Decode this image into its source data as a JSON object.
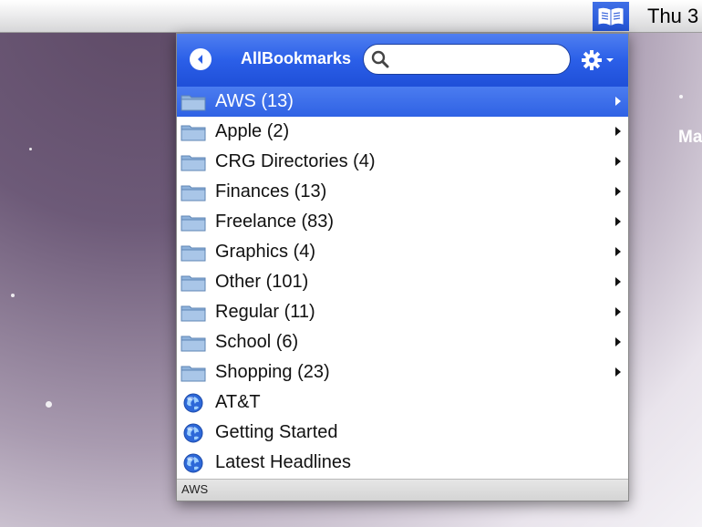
{
  "menubar": {
    "clock": "Thu 3",
    "app_icon": "open-book-icon"
  },
  "desktop": {
    "side_text": "Ma"
  },
  "popover": {
    "title": "AllBookmarks",
    "search_placeholder": "",
    "back_icon": "back-arrow-icon",
    "gear_icon": "gear-icon",
    "items": [
      {
        "label": "AWS (13)",
        "type": "folder",
        "selected": true
      },
      {
        "label": "Apple (2)",
        "type": "folder"
      },
      {
        "label": "CRG Directories (4)",
        "type": "folder"
      },
      {
        "label": "Finances (13)",
        "type": "folder"
      },
      {
        "label": "Freelance (83)",
        "type": "folder"
      },
      {
        "label": "Graphics (4)",
        "type": "folder"
      },
      {
        "label": "Other (101)",
        "type": "folder"
      },
      {
        "label": "Regular (11)",
        "type": "folder"
      },
      {
        "label": "School (6)",
        "type": "folder"
      },
      {
        "label": "Shopping (23)",
        "type": "folder"
      },
      {
        "label": "AT&T",
        "type": "link"
      },
      {
        "label": "Getting Started",
        "type": "link"
      },
      {
        "label": "Latest Headlines",
        "type": "link"
      }
    ],
    "status": "AWS"
  },
  "colors": {
    "header_blue": "#2b5fe8",
    "selection_blue": "#3a6cec",
    "folder_blue": "#8fb3dc"
  }
}
